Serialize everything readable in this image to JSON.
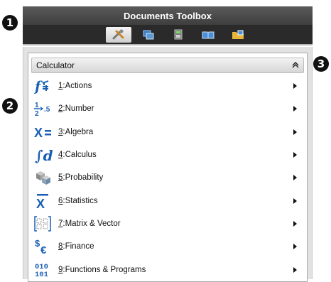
{
  "callouts": [
    "1",
    "2",
    "3"
  ],
  "toolbox": {
    "title": "Documents Toolbox",
    "tabs": [
      {
        "icon": "tools-icon",
        "active": true
      },
      {
        "icon": "page-sorter-icon",
        "active": false
      },
      {
        "icon": "scratchpad-icon",
        "active": false
      },
      {
        "icon": "content-explorer-icon",
        "active": false
      },
      {
        "icon": "utilities-icon",
        "active": false
      }
    ]
  },
  "panel": {
    "title": "Calculator",
    "collapse_glyph": "»",
    "items": [
      {
        "key": "1",
        "label": ":Actions",
        "icon": "actions-icon"
      },
      {
        "key": "2",
        "label": ":Number",
        "icon": "number-icon"
      },
      {
        "key": "3",
        "label": ":Algebra",
        "icon": "algebra-icon"
      },
      {
        "key": "4",
        "label": ":Calculus",
        "icon": "calculus-icon"
      },
      {
        "key": "5",
        "label": ":Probability",
        "icon": "probability-icon"
      },
      {
        "key": "6",
        "label": ":Statistics",
        "icon": "statistics-icon"
      },
      {
        "key": "7",
        "label": ":Matrix & Vector",
        "icon": "matrix-icon"
      },
      {
        "key": "8",
        "label": ":Finance",
        "icon": "finance-icon"
      },
      {
        "key": "9",
        "label": ":Functions & Programs",
        "icon": "functions-programs-icon"
      }
    ]
  },
  "colors": {
    "accent_blue": "#1a5fb4",
    "title_bar": "#4a4a4a",
    "tab_bar": "#2a2a2a"
  }
}
